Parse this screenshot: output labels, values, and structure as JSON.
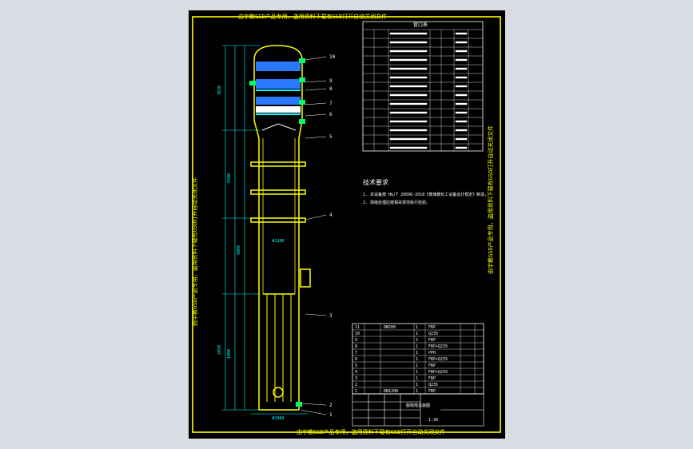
{
  "drawing": {
    "watermark_top": "由宇教GSD产品专用，盗用资料下载有GSD打开自动关闭文件",
    "watermark_left": "由宇教GSD产品专用，盗用资料下载有GSD打开自动关闭文件",
    "watermark_right": "由宇教GSD产品专用，盗用资料下载有GSD打开自动关闭文件",
    "watermark_bottom": "由宇教GSD产品专用，盗用资料下载有GSD打开自动关闭文件",
    "nozzle_table_title": "管口表",
    "notes_title": "技术要求",
    "notes_lines": [
      "1. 本设备按 HG/T 20696-2018《玻璃钢化工设备设计规定》制造，",
      "2. 焊缝处理应按相关规范执行检验。"
    ],
    "dimension_labels": [
      "3650",
      "5500",
      "9000",
      "2050",
      "1000",
      "Φ1200",
      "Φ1000"
    ],
    "part_callouts": [
      "10",
      "9",
      "8",
      "7",
      "6",
      "5",
      "4",
      "3",
      "2",
      "1"
    ],
    "parts_table": [
      {
        "no": "11",
        "code": "DN200",
        "qty": "1",
        "mat": "FRP"
      },
      {
        "no": "10",
        "code": "",
        "qty": "1",
        "mat": "Q235"
      },
      {
        "no": "9",
        "code": "",
        "qty": "2",
        "mat": "FRP"
      },
      {
        "no": "8",
        "code": "",
        "qty": "1",
        "mat": "FRP+Q235"
      },
      {
        "no": "7",
        "code": "",
        "qty": "1",
        "mat": "PPH"
      },
      {
        "no": "6",
        "code": "",
        "qty": "1",
        "mat": "FRP+Q235"
      },
      {
        "no": "5",
        "code": "",
        "qty": "1",
        "mat": "FRP"
      },
      {
        "no": "4",
        "code": "",
        "qty": "1",
        "mat": "FRP+Q235"
      },
      {
        "no": "3",
        "code": "",
        "qty": "1",
        "mat": "FRP"
      },
      {
        "no": "2",
        "code": "",
        "qty": "1",
        "mat": "Q235"
      },
      {
        "no": "1",
        "code": "DN1200",
        "qty": "1",
        "mat": "FRP"
      }
    ],
    "title_block_name": "脱硫塔总装图",
    "title_block_scale": "1:30",
    "colors": {
      "frame": "#ffff00",
      "vessel": "#ffff00",
      "packing": "#2a78ff",
      "detail": "#00ffff",
      "annotation": "#ffffff",
      "nozzle": "#00ff66",
      "watermark": "#ffff00",
      "background": "#000000"
    }
  }
}
